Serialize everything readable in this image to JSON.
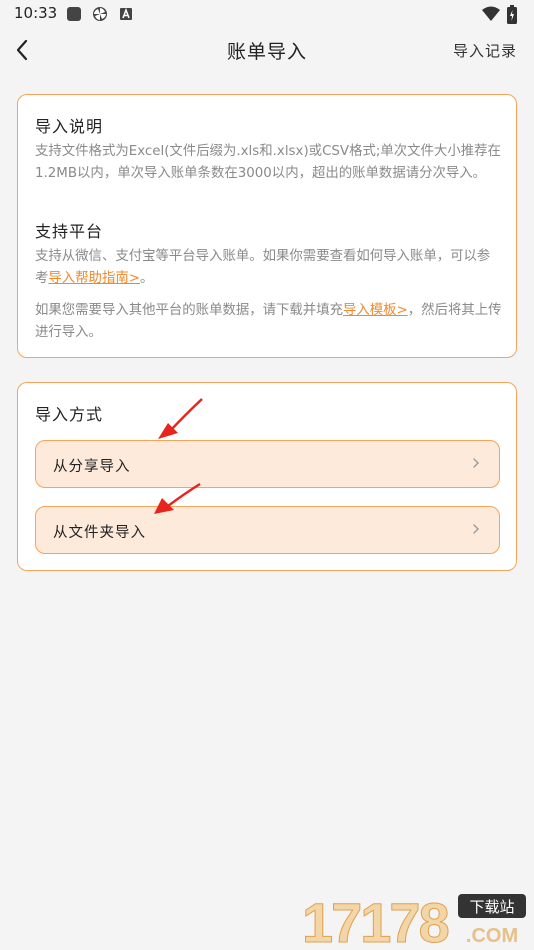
{
  "status_bar": {
    "time": "10:33",
    "left_icons": [
      "app-square-icon",
      "pinwheel-icon",
      "a-badge-icon"
    ],
    "right_icons": [
      "wifi-icon",
      "battery-icon"
    ]
  },
  "header": {
    "back_icon": "chevron-left-icon",
    "title": "账单导入",
    "history_link": "导入记录"
  },
  "info_card": {
    "section1_title": "导入说明",
    "section1_text": "支持文件格式为Excel(文件后缀为.xls和.xlsx)或CSV格式;单次文件大小推荐在1.2MB以内，单次导入账单条数在3000以内，超出的账单数据请分次导入。",
    "section2_title": "支持平台",
    "section2_text_before": "支持从微信、支付宝等平台导入账单。如果你需要查看如何导入账单，可以参考",
    "section2_link": "导入帮助指南>",
    "section2_text_after": "。",
    "section3_text_before": "如果您需要导入其他平台的账单数据，请下载并填充",
    "section3_link": "导入模板>",
    "section3_text_after": "，然后将其上传进行导入。"
  },
  "methods_card": {
    "title": "导入方式",
    "options": [
      {
        "label": "从分享导入",
        "icon": "chevron-right-icon"
      },
      {
        "label": "从文件夹导入",
        "icon": "chevron-right-icon"
      }
    ]
  },
  "watermark": {
    "logo_text": "17178",
    "badge_text": "下载站",
    "domain_text": ".COM"
  },
  "colors": {
    "accent": "#f5a45c",
    "link": "#f08a2c",
    "button_bg": "#fdeadb",
    "annotation_arrow": "#e8251c"
  }
}
